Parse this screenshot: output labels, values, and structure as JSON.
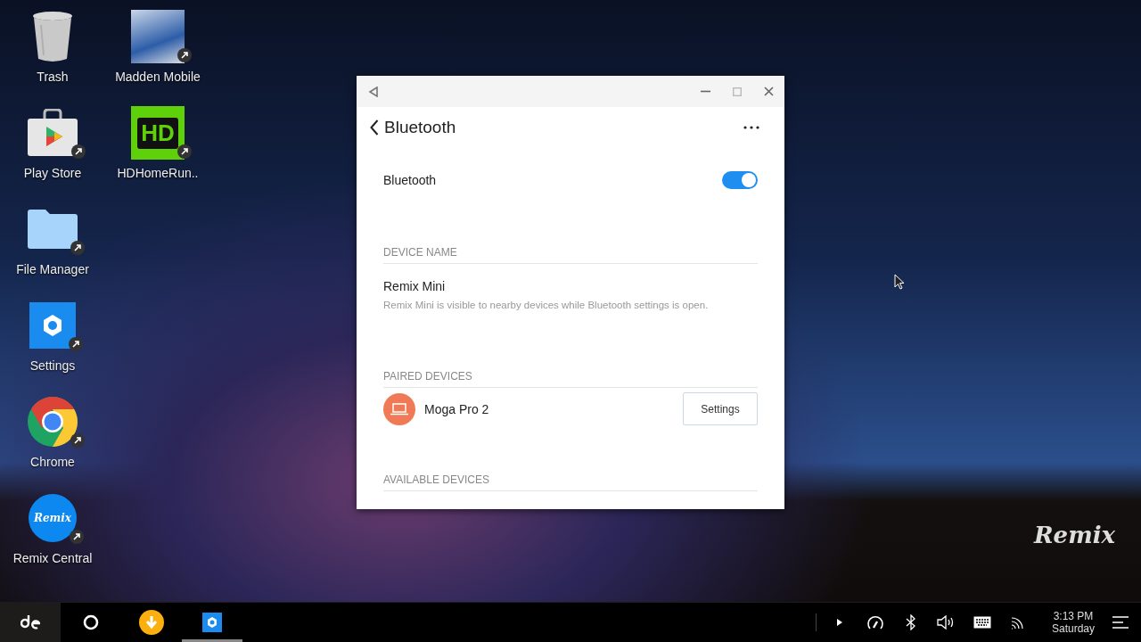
{
  "desktop_columns": [
    {
      "icons": [
        {
          "label": "Trash",
          "kind": "trash",
          "shortcut": false
        },
        {
          "label": "Play Store",
          "kind": "store",
          "shortcut": true
        },
        {
          "label": "File Manager",
          "kind": "folder",
          "shortcut": true
        },
        {
          "label": "Settings",
          "kind": "settings",
          "shortcut": true
        },
        {
          "label": "Chrome",
          "kind": "chrome",
          "shortcut": true
        },
        {
          "label": "Remix Central",
          "kind": "remix",
          "badge_text": "Remix",
          "shortcut": true
        }
      ]
    },
    {
      "icons": [
        {
          "label": "Madden Mobile",
          "kind": "photo",
          "shortcut": true
        },
        {
          "label": "HDHomeRun..",
          "kind": "hd",
          "badge_text": "HD",
          "shortcut": true
        }
      ]
    }
  ],
  "wallpaper_logo": "Remix",
  "window": {
    "header": "Bluetooth",
    "toggle": {
      "label": "Bluetooth",
      "on": true
    },
    "device_name": {
      "heading": "DEVICE NAME",
      "name": "Remix Mini",
      "description": "Remix Mini is visible to nearby devices while Bluetooth settings is open."
    },
    "paired": {
      "heading": "PAIRED DEVICES",
      "devices": [
        {
          "name": "Moga Pro 2",
          "button": "Settings",
          "color": "#f07a55"
        }
      ]
    },
    "available": {
      "heading": "AVAILABLE DEVICES"
    }
  },
  "taskbar": {
    "apps": [
      {
        "kind": "launcher",
        "selected": true,
        "running": false
      },
      {
        "kind": "home",
        "selected": false,
        "running": false
      },
      {
        "kind": "download",
        "selected": false,
        "running": false
      },
      {
        "kind": "settings",
        "selected": false,
        "running": true
      }
    ],
    "tray": [
      {
        "kind": "expand"
      },
      {
        "kind": "gauge"
      },
      {
        "kind": "bluetooth"
      },
      {
        "kind": "volume"
      },
      {
        "kind": "keyboard"
      },
      {
        "kind": "cast"
      }
    ],
    "time": "3:13 PM",
    "day": "Saturday"
  }
}
